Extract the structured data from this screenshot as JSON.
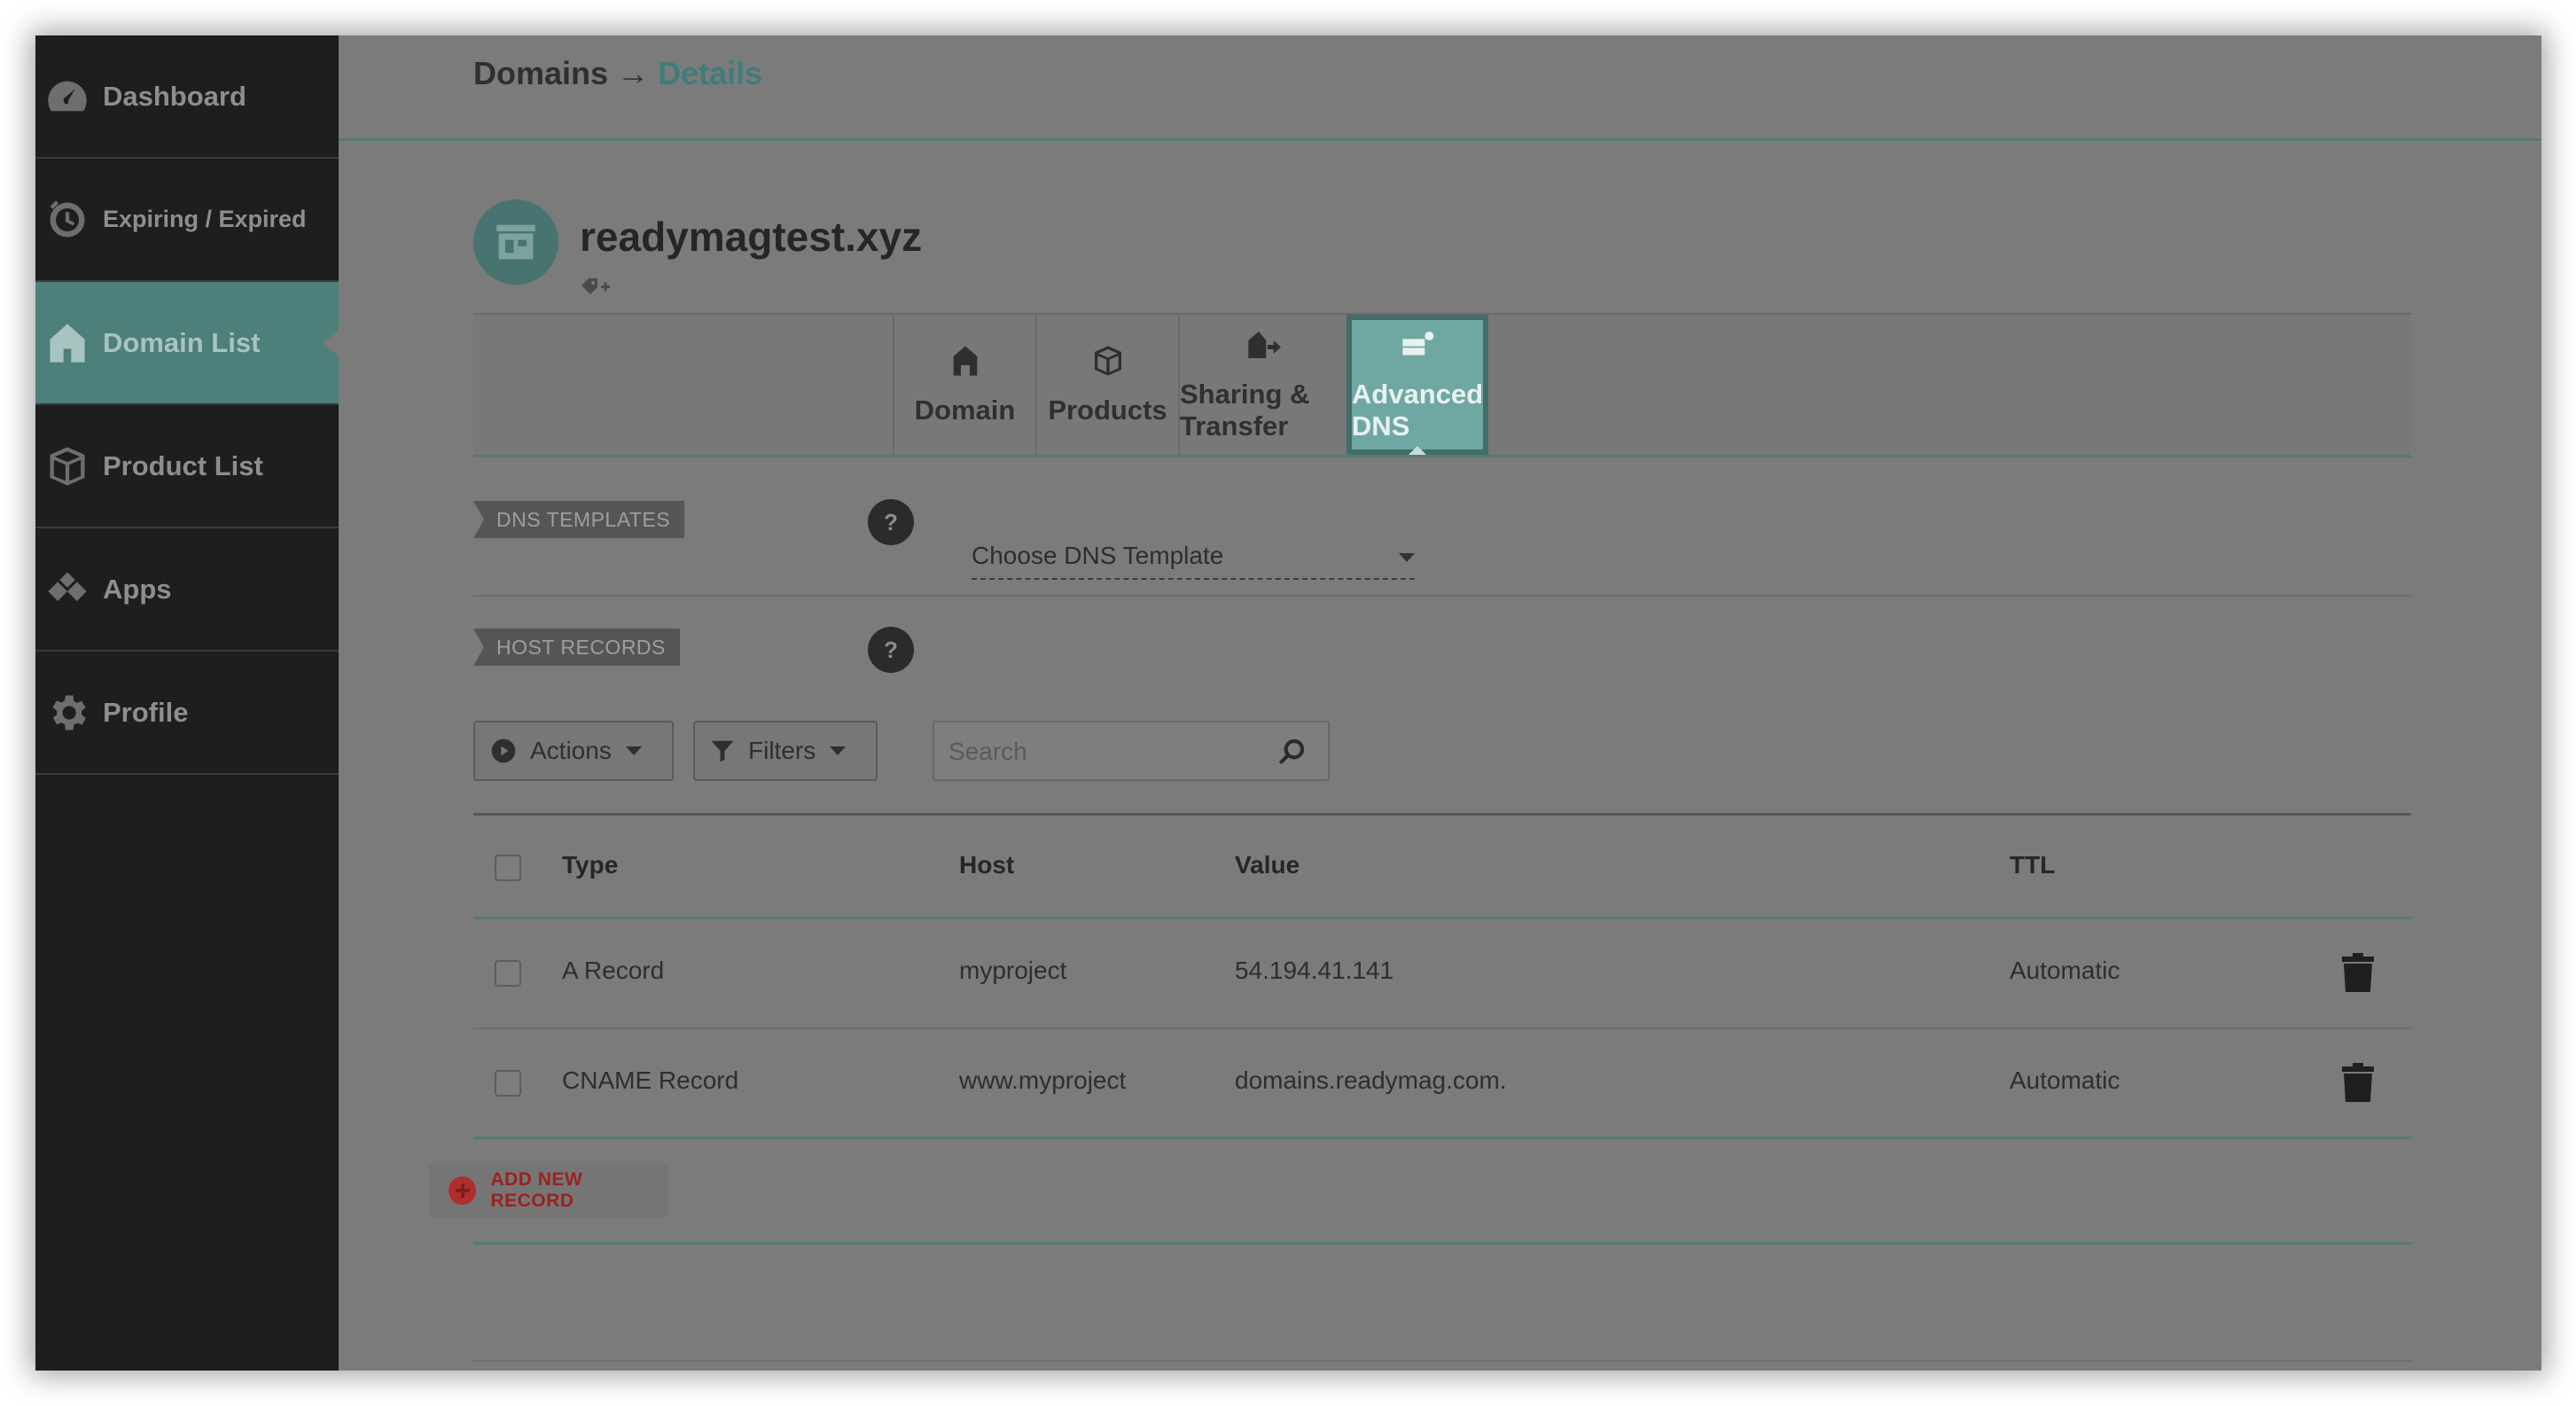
{
  "sidebar": {
    "items": [
      {
        "label": "Dashboard",
        "icon": "speedometer-icon",
        "active": false
      },
      {
        "label": "Expiring / Expired",
        "icon": "clock-icon",
        "active": false
      },
      {
        "label": "Domain List",
        "icon": "house-icon",
        "active": true
      },
      {
        "label": "Product List",
        "icon": "box-icon",
        "active": false
      },
      {
        "label": "Apps",
        "icon": "apps-icon",
        "active": false
      },
      {
        "label": "Profile",
        "icon": "gear-icon",
        "active": false
      }
    ]
  },
  "breadcrumb": {
    "parent": "Domains",
    "separator": " → ",
    "current": "Details"
  },
  "domain": {
    "name": "readymagtest.xyz"
  },
  "tabs": [
    {
      "label": "Domain",
      "icon": "house-icon",
      "active": false
    },
    {
      "label": "Products",
      "icon": "box-icon",
      "active": false
    },
    {
      "label": "Sharing & Transfer",
      "icon": "transfer-icon",
      "active": false
    },
    {
      "label": "Advanced DNS",
      "icon": "server-gear-icon",
      "active": true
    }
  ],
  "dns_templates": {
    "label": "DNS TEMPLATES",
    "help": "?",
    "select_value": "Choose DNS Template"
  },
  "host_records": {
    "label": "HOST RECORDS",
    "help": "?",
    "actions_label": "Actions",
    "filters_label": "Filters",
    "search_placeholder": "Search",
    "columns": [
      "Type",
      "Host",
      "Value",
      "TTL"
    ],
    "rows": [
      {
        "type": "A Record",
        "host": "myproject",
        "value": "54.194.41.141",
        "ttl": "Automatic"
      },
      {
        "type": "CNAME Record",
        "host": "www.myproject",
        "value": "domains.readymag.com.",
        "ttl": "Automatic"
      }
    ],
    "add_label": "ADD NEW RECORD"
  },
  "colors": {
    "accent": "#6fa8a3",
    "sidebar_bg": "#1e1e1e",
    "overlay_bg": "#7b7b7b",
    "danger": "#b02d2d"
  }
}
